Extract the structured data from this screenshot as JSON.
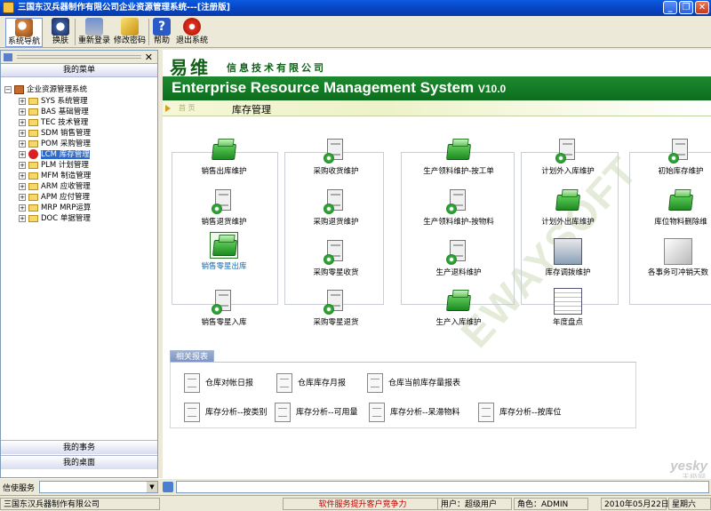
{
  "window": {
    "title": "三国东汉兵器制作有限公司企业资源管理系统---[注册版]"
  },
  "toolbar": {
    "nav": "系统导航",
    "skin": "换肤",
    "relogin": "重新登录",
    "change_pwd": "修改密码",
    "help": "帮助",
    "exit": "退出系统"
  },
  "sidebar": {
    "menu_title": "我的菜单",
    "root": "企业资源管理系统",
    "items": [
      {
        "label": "SYS 系统管理"
      },
      {
        "label": "BAS 基础管理"
      },
      {
        "label": "TEC 技术管理"
      },
      {
        "label": "SDM 销售管理"
      },
      {
        "label": "POM 采购管理"
      },
      {
        "label": "LCM 库存管理"
      },
      {
        "label": "PLM 计划管理"
      },
      {
        "label": "MFM 制造管理"
      },
      {
        "label": "ARM 应收管理"
      },
      {
        "label": "APM 应付管理"
      },
      {
        "label": "MRP MRP运算"
      },
      {
        "label": "DOC 单据管理"
      }
    ],
    "my_tasks": "我的事务",
    "my_desktop": "我的桌面"
  },
  "banner": {
    "logo_cn": "易维",
    "logo_sub": "信息技术有限公司",
    "system_title": "Enterprise Resource Management System",
    "version": "V10.0",
    "breadcrumb_home": "首 页",
    "breadcrumb_current": "库存管理",
    "watermark": "EWAYSOFT"
  },
  "functions": {
    "col1": [
      "销售出库维护",
      "销售退货维护",
      "销售零星出库",
      "销售零星入库"
    ],
    "col2": [
      "采购收货维护",
      "采购退货维护",
      "采购零星收货",
      "采购零星退货"
    ],
    "col3": [
      "生产领料维护-按工单",
      "生产领料维护-按物料",
      "生产退料维护",
      "生产入库维护"
    ],
    "col4": [
      "计划外入库维护",
      "计划外出库维护",
      "库存调拨维护",
      "年度盘点"
    ],
    "col5": [
      "初始库存维护",
      "库位物料删除维",
      "各事务可冲销天数"
    ]
  },
  "reports": {
    "title": "相关报表",
    "row1": [
      "仓库对帐日报",
      "仓库库存月报",
      "仓库当前库存量报表"
    ],
    "row2": [
      "库存分析--按类别",
      "库存分析--可用量",
      "库存分析--呆滞物料",
      "库存分析--按库位"
    ]
  },
  "message_bar": {
    "label": "信使服务"
  },
  "statusbar": {
    "company": "三国东汉兵器制作有限公司",
    "slogan": "软件服务提升客户竞争力",
    "user": "用户：超级用户",
    "role": "角色：ADMIN",
    "date": "2010年05月22日",
    "weekday": "星期六"
  },
  "site_watermark": {
    "main": "yesky",
    "sub": "天极网"
  }
}
